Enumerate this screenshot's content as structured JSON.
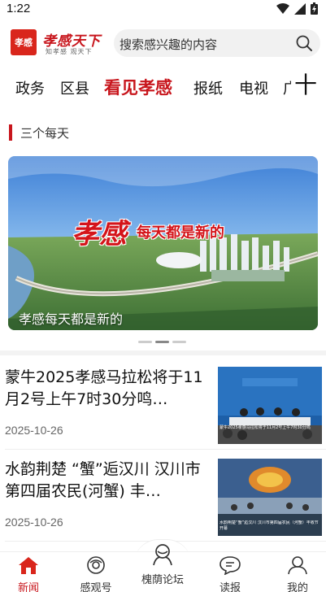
{
  "status": {
    "time": "1:22"
  },
  "header": {
    "logo_seal": "孝感",
    "logo_name": "孝感天下",
    "logo_tagline": "知孝感 观天下",
    "search_placeholder": "搜索感兴趣的内容"
  },
  "nav": {
    "items": [
      "政务",
      "区县",
      "看见孝感",
      "报纸",
      "电视",
      "广"
    ],
    "active_index": 2,
    "more_label": "十"
  },
  "section": {
    "title": "三个每天"
  },
  "banner": {
    "slogan_city": "孝感",
    "slogan_rest": "每天都是新的",
    "caption": "孝感每天都是新的"
  },
  "carousel": {
    "count": 3,
    "active_index": 1
  },
  "news": [
    {
      "title": "蒙牛2025孝感马拉松将于11月2号上午7时30分鸣…",
      "date": "2025-10-26",
      "thumb_caption": "蒙牛2025孝感马拉松将于11月2号上午7时30分鸣"
    },
    {
      "title": "水韵荆楚 “蟹”逅汉川 汉川市第四届农民(河蟹) 丰…",
      "date": "2025-10-26",
      "thumb_caption": "水韵荆楚“蟹”逅汉川 汉川市第四届农民（河蟹）丰收节开幕"
    }
  ],
  "tabbar": {
    "tabs": [
      {
        "label": "新闻",
        "icon": "home-icon"
      },
      {
        "label": "感观号",
        "icon": "eye-disc-icon"
      },
      {
        "label": "槐荫论坛",
        "icon": "discussion-icon"
      },
      {
        "label": "读报",
        "icon": "chat-bubble-icon"
      },
      {
        "label": "我的",
        "icon": "user-icon"
      }
    ],
    "active_index": 0
  },
  "colors": {
    "brand_red": "#c8161d",
    "text": "#111111",
    "muted": "#666666"
  }
}
